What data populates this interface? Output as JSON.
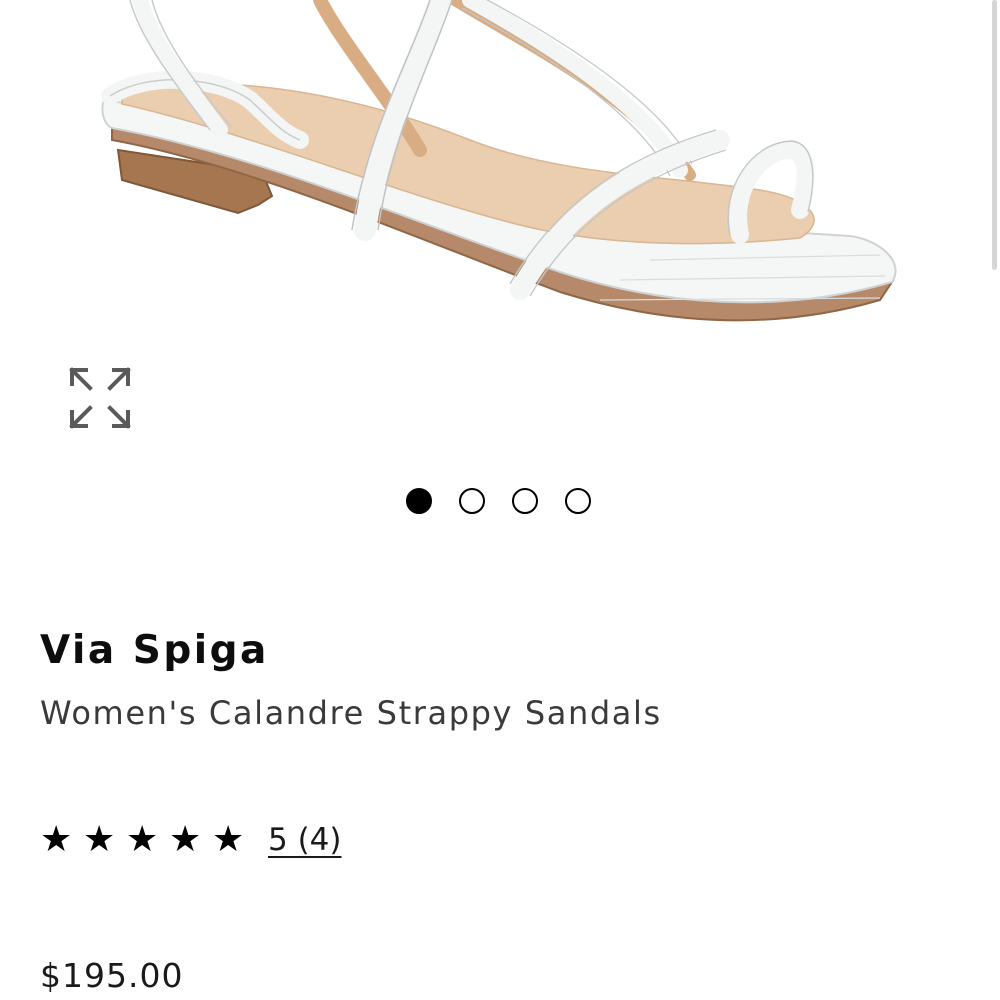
{
  "product": {
    "image_alt": "White lizard-embossed strappy flat sandal",
    "image_count": 4,
    "active_image_index": 0,
    "brand": "Via Spiga",
    "name": "Women's Calandre Strappy Sandals",
    "rating": {
      "stars_filled": 5,
      "stars_total": 5,
      "star_glyph": "★",
      "label": "5 (4)"
    },
    "price": "$195.00"
  },
  "icons": {
    "expand": "expand-icon"
  },
  "colors": {
    "text": "#111111",
    "secondary_text": "#3a3a3a",
    "sandal_white": "#f7f8f8",
    "footbed_tan": "#e9c9a7",
    "sole_brown": "#a9784e"
  }
}
